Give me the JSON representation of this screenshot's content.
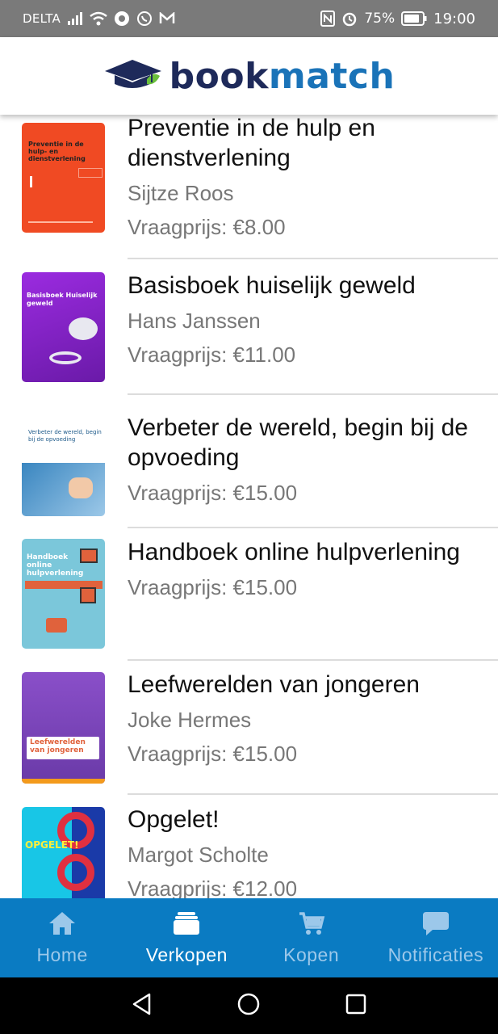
{
  "status_bar": {
    "carrier": "DELTA",
    "battery": "75%",
    "time": "19:00"
  },
  "header": {
    "logo_part1": "book",
    "logo_part2": "match"
  },
  "listings": [
    {
      "title": "Preventie in de hulp en dienstverlening",
      "author": "Sijtze Roos",
      "price": "Vraagprijs: €8.00",
      "cover_text": "Preventie in de hulp- en dienstverlening"
    },
    {
      "title": "Basisboek huiselijk geweld",
      "author": "Hans Janssen",
      "price": "Vraagprijs: €11.00",
      "cover_text": "Basisboek Huiselijk geweld"
    },
    {
      "title": "Verbeter de wereld, begin bij de opvoeding",
      "author": "",
      "price": "Vraagprijs: €15.00",
      "cover_text": "Verbeter de wereld, begin bij de opvoeding"
    },
    {
      "title": "Handboek online hulpverlening",
      "author": "",
      "price": "Vraagprijs: €15.00",
      "cover_text": "Handboek online hulpverlening"
    },
    {
      "title": "Leefwerelden van jongeren",
      "author": "Joke Hermes",
      "price": "Vraagprijs: €15.00",
      "cover_text": "Leefwerelden van jongeren"
    },
    {
      "title": "Opgelet!",
      "author": "Margot Scholte",
      "price": "Vraagprijs: €12.00",
      "cover_text": "OPGELET!"
    }
  ],
  "bottom_nav": [
    {
      "label": "Home",
      "icon": "home-icon",
      "active": false
    },
    {
      "label": "Verkopen",
      "icon": "stack-icon",
      "active": true
    },
    {
      "label": "Kopen",
      "icon": "cart-icon",
      "active": false
    },
    {
      "label": "Notificaties",
      "icon": "chat-icon",
      "active": false
    }
  ],
  "colors": {
    "brand_dark": "#1e2a5a",
    "brand_blue": "#1a73b8",
    "nav_bg": "#0a7bc2"
  }
}
